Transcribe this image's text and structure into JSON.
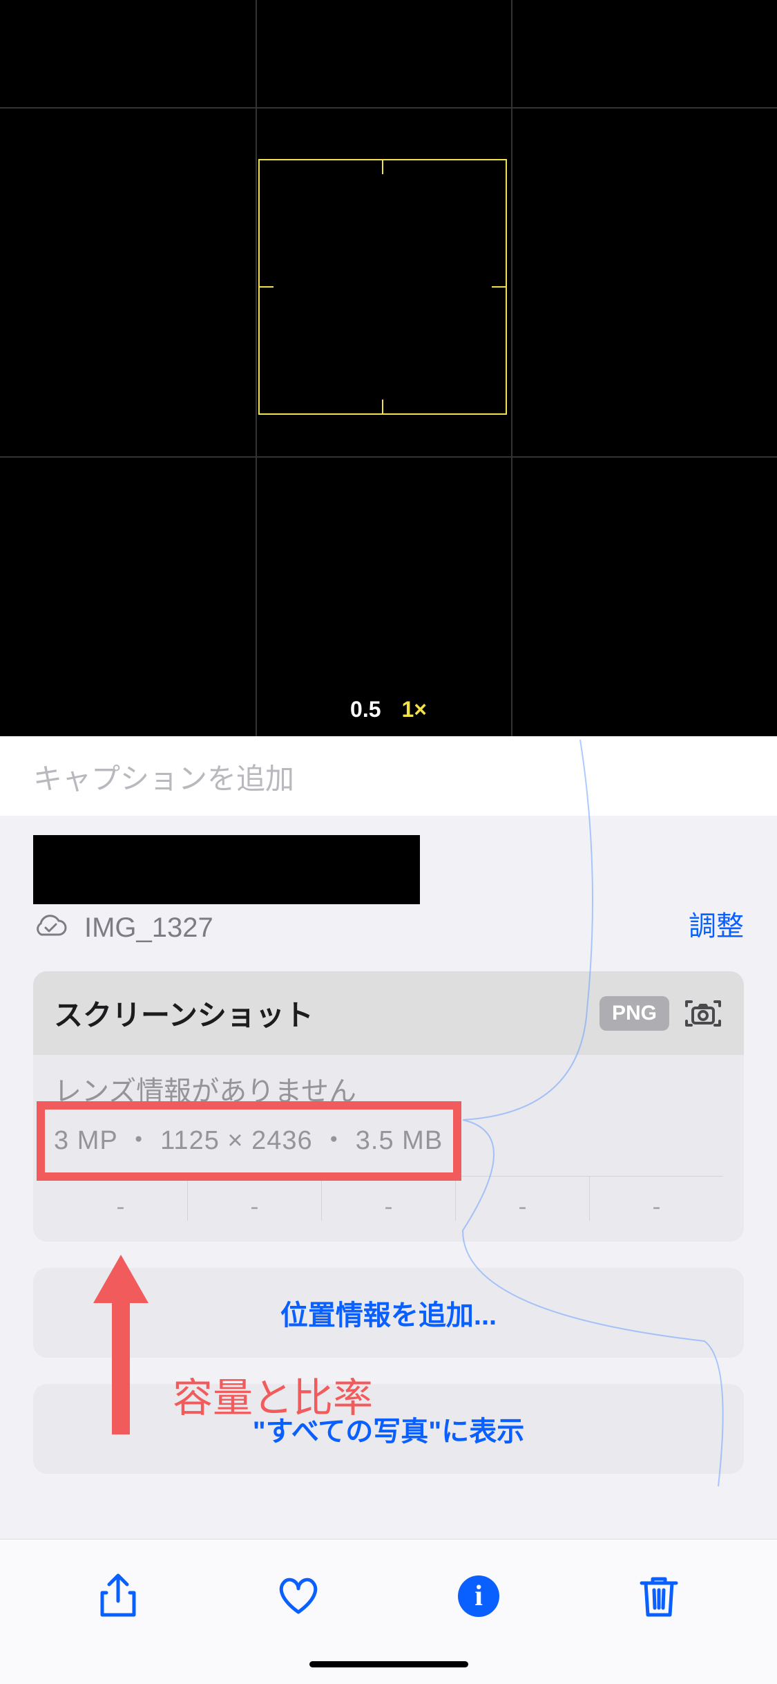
{
  "photo": {
    "zoom_option_1": "0.5",
    "zoom_option_2": "1×"
  },
  "caption": {
    "placeholder": "キャプションを追加"
  },
  "file": {
    "name": "IMG_1327",
    "adjust": "調整"
  },
  "info": {
    "title": "スクリーンショット",
    "format_badge": "PNG",
    "lens_text": "レンズ情報がありません",
    "specs": "3 MP ・ 1125 × 2436 ・ 3.5 MB",
    "dashes": [
      "-",
      "-",
      "-",
      "-",
      "-"
    ]
  },
  "annotation": {
    "label": "容量と比率"
  },
  "actions": {
    "add_location": "位置情報を追加...",
    "show_all": "\"すべての写真\"に表示"
  }
}
